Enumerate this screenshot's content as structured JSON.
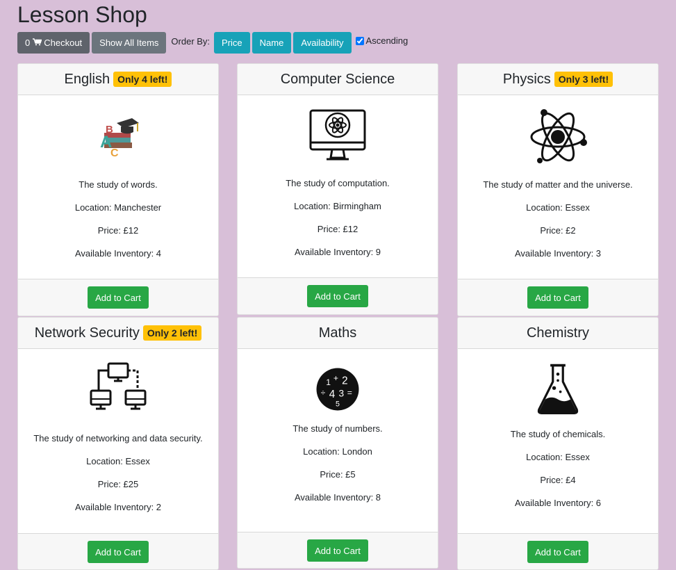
{
  "page": {
    "title": "Lesson Shop"
  },
  "toolbar": {
    "checkout_count": "0",
    "checkout_label": "Checkout",
    "show_all_label": "Show All Items",
    "order_by_label": "Order By:",
    "sort_price": "Price",
    "sort_name": "Name",
    "sort_availability": "Availability",
    "ascending_label": "Ascending",
    "ascending_checked": true
  },
  "colors": {
    "background": "#d8bfd8",
    "info": "#17a2b8",
    "success": "#28a745",
    "warning": "#ffc107",
    "secondary": "#6c757d"
  },
  "lessons": [
    {
      "name": "English",
      "badge": "Only 4 left!",
      "icon": "abc-books-icon",
      "description": "The study of words.",
      "location": "Location: Manchester",
      "price": "Price: £12",
      "inventory": "Available Inventory: 4",
      "button": "Add to Cart"
    },
    {
      "name": "Computer Science",
      "badge": "",
      "icon": "computer-atom-icon",
      "description": "The study of computation.",
      "location": "Location: Birmingham",
      "price": "Price: £12",
      "inventory": "Available Inventory: 9",
      "button": "Add to Cart"
    },
    {
      "name": "Physics",
      "badge": "Only 3 left!",
      "icon": "atom-icon",
      "description": "The study of matter and the universe.",
      "location": "Location: Essex",
      "price": "Price: £2",
      "inventory": "Available Inventory: 3",
      "button": "Add to Cart"
    },
    {
      "name": "Network Security",
      "badge": "Only 2 left!",
      "icon": "network-icon",
      "description": "The study of networking and data security.",
      "location": "Location: Essex",
      "price": "Price: £25",
      "inventory": "Available Inventory: 2",
      "button": "Add to Cart"
    },
    {
      "name": "Maths",
      "badge": "",
      "icon": "numbers-icon",
      "description": "The study of numbers.",
      "location": "Location: London",
      "price": "Price: £5",
      "inventory": "Available Inventory: 8",
      "button": "Add to Cart"
    },
    {
      "name": "Chemistry",
      "badge": "",
      "icon": "flask-icon",
      "description": "The study of chemicals.",
      "location": "Location: Essex",
      "price": "Price: £4",
      "inventory": "Available Inventory: 6",
      "button": "Add to Cart"
    }
  ]
}
